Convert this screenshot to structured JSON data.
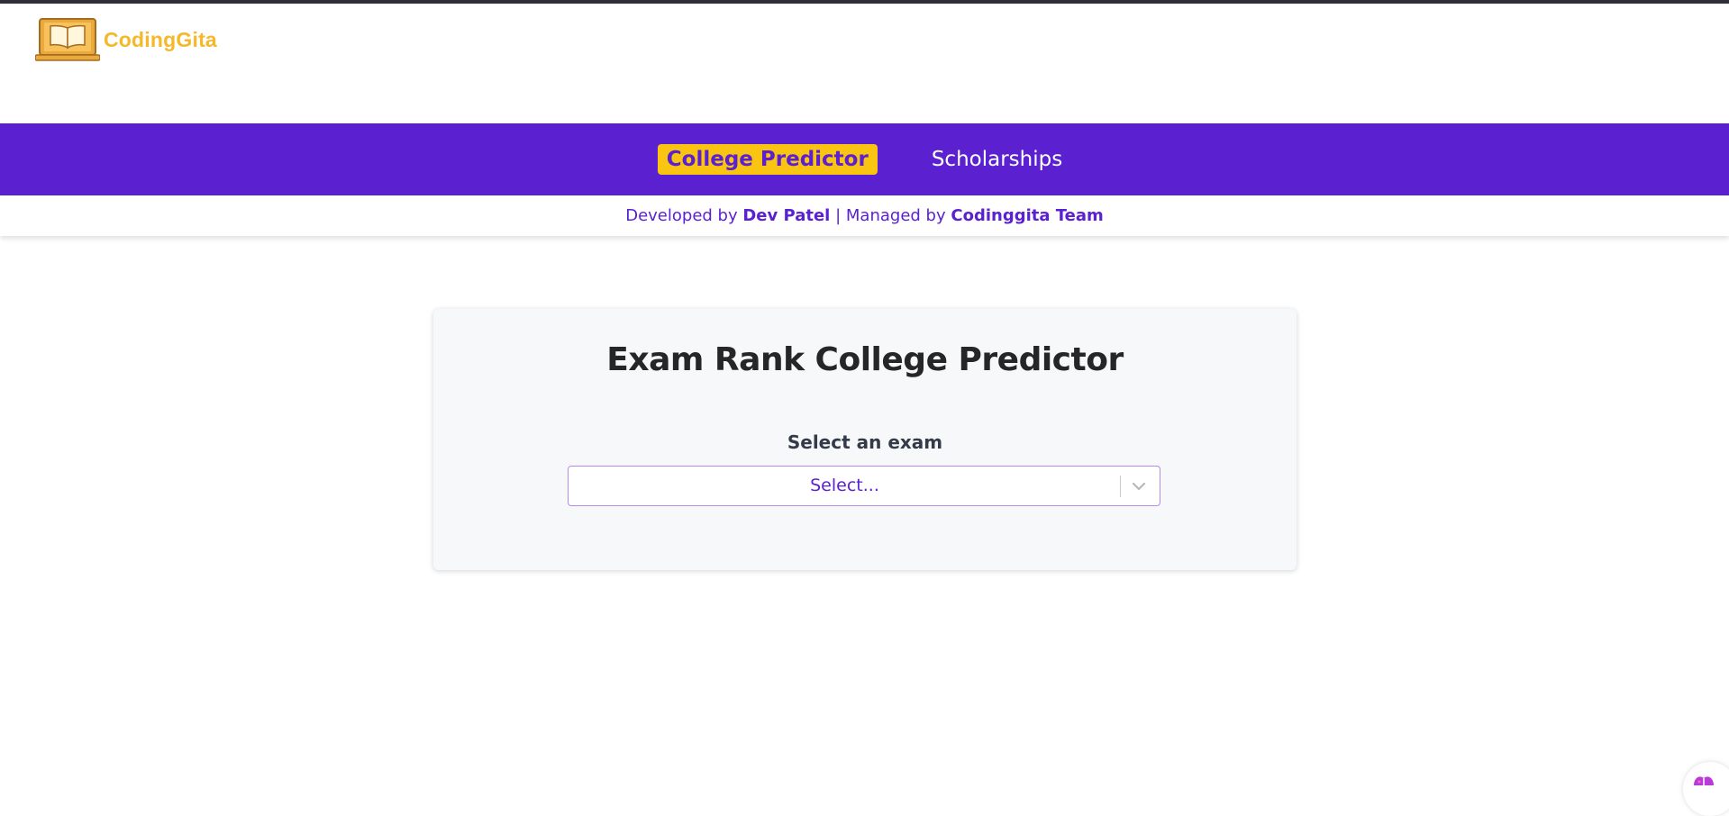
{
  "brand": {
    "name": "CodingGita",
    "color": "#f5b829"
  },
  "nav": {
    "items": [
      {
        "label": "College Predictor",
        "active": true
      },
      {
        "label": "Scholarships",
        "active": false
      }
    ],
    "background": "#5b21d0",
    "active_highlight": "#f9c412"
  },
  "credits": {
    "developed_prefix": "Developed by",
    "developer": "Dev Patel",
    "separator": "|",
    "managed_prefix": "Managed by",
    "manager": "Codinggita Team"
  },
  "card": {
    "title": "Exam Rank College Predictor",
    "exam_label": "Select an exam",
    "exam_placeholder": "Select..."
  },
  "icons": {
    "logo": "open-book-laptop-icon",
    "dropdown": "chevron-down-icon",
    "corner": "chat-widget-icon"
  }
}
